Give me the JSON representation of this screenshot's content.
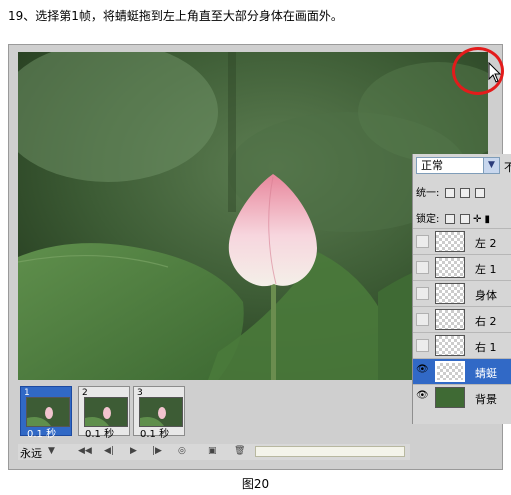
{
  "instruction": "19、选择第1帧，将蜻蜓拖到左上角直至大部分身体在画面外。",
  "layers_panel": {
    "blend_mode": "正常",
    "blend_cut": "不",
    "unify_label": "统一:",
    "lock_label": "锁定:",
    "layers": [
      {
        "name": "左 2",
        "visible": false,
        "active": false
      },
      {
        "name": "左 1",
        "visible": false,
        "active": false
      },
      {
        "name": "身体",
        "visible": false,
        "active": false
      },
      {
        "name": "右 2",
        "visible": false,
        "active": false
      },
      {
        "name": "右 1",
        "visible": false,
        "active": false
      },
      {
        "name": "蜻蜓",
        "visible": true,
        "active": true
      },
      {
        "name": "背景",
        "visible": true,
        "active": false
      }
    ]
  },
  "animation": {
    "frames": [
      {
        "number": "1",
        "time": "0.1 秒",
        "selected": true
      },
      {
        "number": "2",
        "time": "0.1 秒",
        "selected": false
      },
      {
        "number": "3",
        "time": "0.1 秒",
        "selected": false
      }
    ],
    "loop": "永远"
  },
  "caption": "图20",
  "colors": {
    "selection": "#3169c6",
    "highlight_circle": "#e31b1b"
  }
}
